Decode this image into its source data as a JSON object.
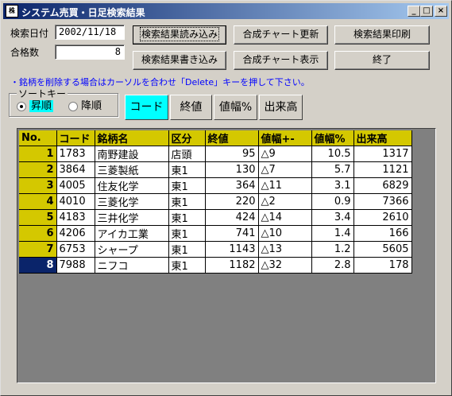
{
  "window": {
    "title": "システム売買・日足検索結果",
    "app_icon_text": "株",
    "buttons": {
      "minimize": "_",
      "maximize": "□",
      "close": "×"
    }
  },
  "form": {
    "date_label": "検索日付",
    "date_value": "2002/11/18",
    "count_label": "合格数",
    "count_value": "8"
  },
  "actions": {
    "load": "検索結果読み込み",
    "save": "検索結果書き込み",
    "chart_update": "合成チャート更新",
    "chart_show": "合成チャート表示",
    "print": "検索結果印刷",
    "exit": "終了"
  },
  "note": "・銘柄を削除する場合はカーソルを合わせ「Delete」キーを押して下さい。",
  "sort": {
    "group_label": "ソートキー",
    "asc": "昇順",
    "desc": "降順",
    "selected_order": "asc",
    "keys": [
      "コード",
      "終値",
      "値幅%",
      "出来高"
    ],
    "active_key": "コード"
  },
  "table": {
    "columns": [
      "No.",
      "コード",
      "銘柄名",
      "区分",
      "終値",
      "値幅+-",
      "値幅%",
      "出来高"
    ],
    "rows": [
      [
        "1",
        "1783",
        "南野建設",
        "店頭",
        "95",
        "△9",
        "10.5",
        "1317"
      ],
      [
        "2",
        "3864",
        "三菱製紙",
        "東1",
        "130",
        "△7",
        "5.7",
        "1121"
      ],
      [
        "3",
        "4005",
        "住友化学",
        "東1",
        "364",
        "△11",
        "3.1",
        "6829"
      ],
      [
        "4",
        "4010",
        "三菱化学",
        "東1",
        "220",
        "△2",
        "0.9",
        "7366"
      ],
      [
        "5",
        "4183",
        "三井化学",
        "東1",
        "424",
        "△14",
        "3.4",
        "2610"
      ],
      [
        "6",
        "4206",
        "アイカ工業",
        "東1",
        "741",
        "△10",
        "1.4",
        "166"
      ],
      [
        "7",
        "6753",
        "シャープ",
        "東1",
        "1143",
        "△13",
        "1.2",
        "5605"
      ],
      [
        "8",
        "7988",
        "ニフコ",
        "東1",
        "1182",
        "△32",
        "2.8",
        "178"
      ]
    ],
    "selected_row": 8
  }
}
